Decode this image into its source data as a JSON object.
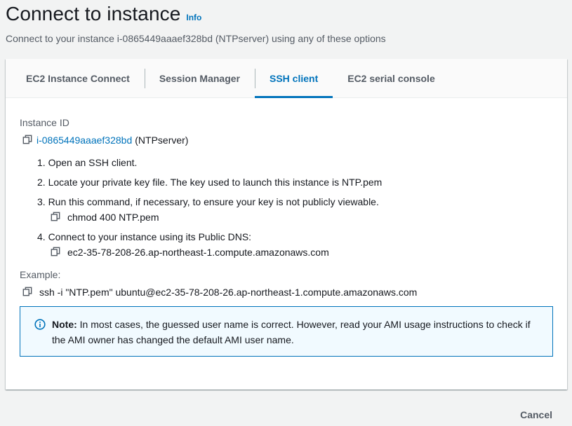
{
  "header": {
    "title": "Connect to instance",
    "info_label": "Info",
    "subtitle": "Connect to your instance i-0865449aaaef328bd (NTPserver) using any of these options"
  },
  "tabs": [
    {
      "label": "EC2 Instance Connect",
      "active": false
    },
    {
      "label": "Session Manager",
      "active": false
    },
    {
      "label": "SSH client",
      "active": true
    },
    {
      "label": "EC2 serial console",
      "active": false
    }
  ],
  "instance": {
    "label": "Instance ID",
    "id": "i-0865449aaaef328bd",
    "name": "(NTPserver)"
  },
  "steps": [
    {
      "text": "1. Open an SSH client."
    },
    {
      "text": "2. Locate your private key file. The key used to launch this instance is NTP.pem"
    },
    {
      "text": "3. Run this command, if necessary, to ensure your key is not publicly viewable.",
      "command": "chmod 400 NTP.pem"
    },
    {
      "text": "4. Connect to your instance using its Public DNS:",
      "command": "ec2-35-78-208-26.ap-northeast-1.compute.amazonaws.com"
    }
  ],
  "example": {
    "label": "Example:",
    "command": "ssh -i \"NTP.pem\" ubuntu@ec2-35-78-208-26.ap-northeast-1.compute.amazonaws.com"
  },
  "note": {
    "title": "Note:",
    "text": " In most cases, the guessed user name is correct. However, read your AMI usage instructions to check if the AMI owner has changed the default AMI user name."
  },
  "footer": {
    "cancel_label": "Cancel"
  },
  "colors": {
    "accent": "#0073bb",
    "note_background": "#f1faff",
    "page_background": "#f2f3f3"
  },
  "icons": {
    "copy": "copy-icon",
    "info": "info-circle-icon"
  }
}
